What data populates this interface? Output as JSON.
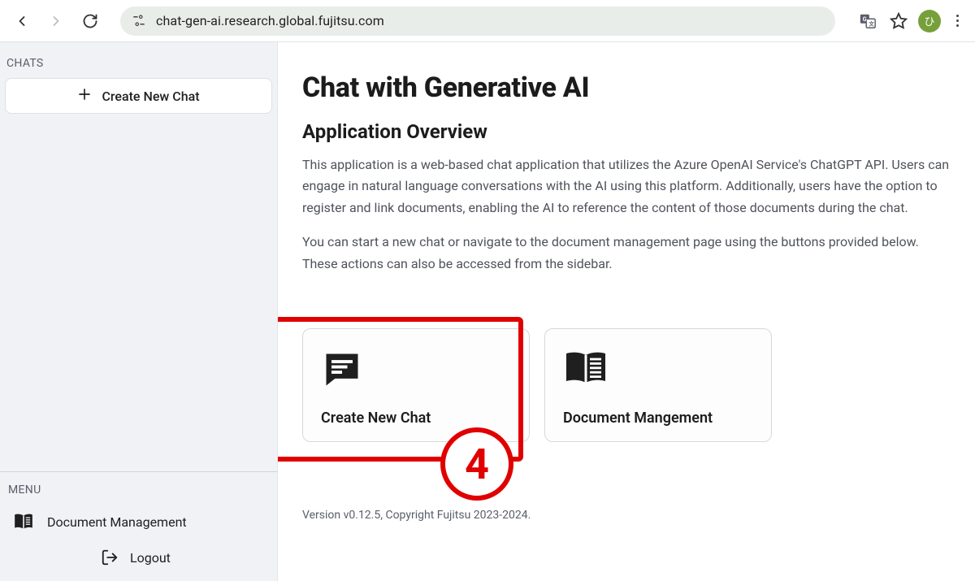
{
  "browser": {
    "url": "chat-gen-ai.research.global.fujitsu.com",
    "avatar_initial": "ひ"
  },
  "sidebar": {
    "chats_label": "CHATS",
    "new_chat_label": "Create New Chat",
    "menu_label": "MENU",
    "doc_mgmt_label": "Document Management",
    "logout_label": "Logout"
  },
  "main": {
    "title": "Chat with Generative AI",
    "overview_heading": "Application Overview",
    "overview_p1": "This application is a web-based chat application that utilizes the Azure OpenAI Service's ChatGPT API. Users can engage in natural language conversations with the AI using this platform. Additionally, users have the option to register and link documents, enabling the AI to reference the content of those documents during the chat.",
    "overview_p2": "You can start a new chat or navigate to the document management page using the buttons provided below. These actions can also be accessed from the sidebar.",
    "card_new_chat": "Create New Chat",
    "card_doc_mgmt": "Document Mangement",
    "footer": "Version v0.12.5, Copyright Fujitsu 2023-2024."
  },
  "annotation": {
    "callout_number": "4"
  }
}
